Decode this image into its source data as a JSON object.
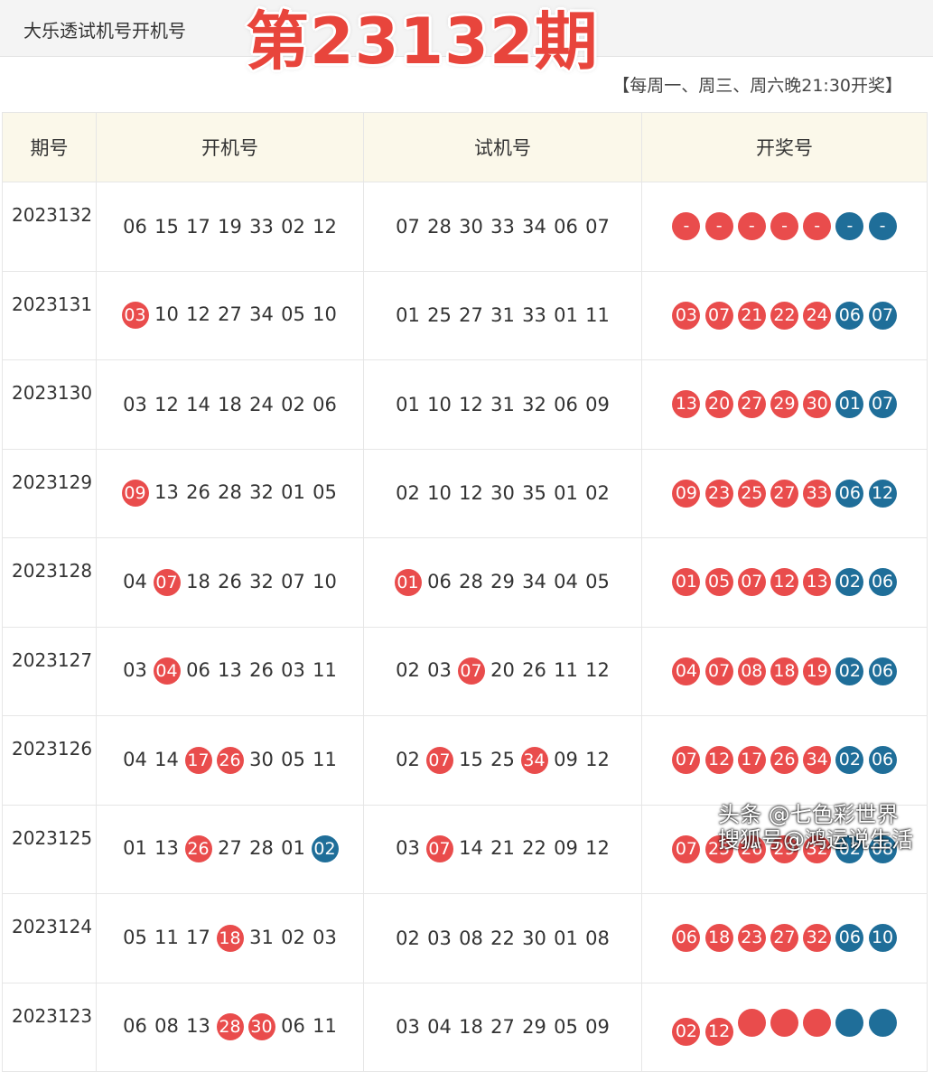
{
  "header": {
    "app_title": "大乐透试机号开机号",
    "issue_title": "第23132期",
    "schedule": "【每周一、周三、周六晚21:30开奖】"
  },
  "table": {
    "columns": [
      "期号",
      "开机号",
      "试机号",
      "开奖号"
    ],
    "rows": [
      {
        "issue": "2023132",
        "open": [
          [
            "06",
            ""
          ],
          [
            "15",
            ""
          ],
          [
            "17",
            ""
          ],
          [
            "19",
            ""
          ],
          [
            "33",
            ""
          ],
          [
            "02",
            ""
          ],
          [
            "12",
            ""
          ]
        ],
        "test": [
          [
            "07",
            ""
          ],
          [
            "28",
            ""
          ],
          [
            "30",
            ""
          ],
          [
            "33",
            ""
          ],
          [
            "34",
            ""
          ],
          [
            "06",
            ""
          ],
          [
            "07",
            ""
          ]
        ],
        "draw": [
          [
            "-",
            "red"
          ],
          [
            "-",
            "red"
          ],
          [
            "-",
            "red"
          ],
          [
            "-",
            "red"
          ],
          [
            "-",
            "red"
          ],
          [
            "-",
            "blue"
          ],
          [
            "-",
            "blue"
          ]
        ]
      },
      {
        "issue": "2023131",
        "open": [
          [
            "03",
            "hit"
          ],
          [
            "10",
            ""
          ],
          [
            "12",
            ""
          ],
          [
            "27",
            ""
          ],
          [
            "34",
            ""
          ],
          [
            "05",
            ""
          ],
          [
            "10",
            ""
          ]
        ],
        "test": [
          [
            "01",
            ""
          ],
          [
            "25",
            ""
          ],
          [
            "27",
            ""
          ],
          [
            "31",
            ""
          ],
          [
            "33",
            ""
          ],
          [
            "01",
            ""
          ],
          [
            "11",
            ""
          ]
        ],
        "draw": [
          [
            "03",
            "red"
          ],
          [
            "07",
            "red"
          ],
          [
            "21",
            "red"
          ],
          [
            "22",
            "red"
          ],
          [
            "24",
            "red"
          ],
          [
            "06",
            "blue"
          ],
          [
            "07",
            "blue"
          ]
        ]
      },
      {
        "issue": "2023130",
        "open": [
          [
            "03",
            ""
          ],
          [
            "12",
            ""
          ],
          [
            "14",
            ""
          ],
          [
            "18",
            ""
          ],
          [
            "24",
            ""
          ],
          [
            "02",
            ""
          ],
          [
            "06",
            ""
          ]
        ],
        "test": [
          [
            "01",
            ""
          ],
          [
            "10",
            ""
          ],
          [
            "12",
            ""
          ],
          [
            "31",
            ""
          ],
          [
            "32",
            ""
          ],
          [
            "06",
            ""
          ],
          [
            "09",
            ""
          ]
        ],
        "draw": [
          [
            "13",
            "red"
          ],
          [
            "20",
            "red"
          ],
          [
            "27",
            "red"
          ],
          [
            "29",
            "red"
          ],
          [
            "30",
            "red"
          ],
          [
            "01",
            "blue"
          ],
          [
            "07",
            "blue"
          ]
        ]
      },
      {
        "issue": "2023129",
        "open": [
          [
            "09",
            "hit"
          ],
          [
            "13",
            ""
          ],
          [
            "26",
            ""
          ],
          [
            "28",
            ""
          ],
          [
            "32",
            ""
          ],
          [
            "01",
            ""
          ],
          [
            "05",
            ""
          ]
        ],
        "test": [
          [
            "02",
            ""
          ],
          [
            "10",
            ""
          ],
          [
            "12",
            ""
          ],
          [
            "30",
            ""
          ],
          [
            "35",
            ""
          ],
          [
            "01",
            ""
          ],
          [
            "02",
            ""
          ]
        ],
        "draw": [
          [
            "09",
            "red"
          ],
          [
            "23",
            "red"
          ],
          [
            "25",
            "red"
          ],
          [
            "27",
            "red"
          ],
          [
            "33",
            "red"
          ],
          [
            "06",
            "blue"
          ],
          [
            "12",
            "blue"
          ]
        ]
      },
      {
        "issue": "2023128",
        "open": [
          [
            "04",
            ""
          ],
          [
            "07",
            "hit"
          ],
          [
            "18",
            ""
          ],
          [
            "26",
            ""
          ],
          [
            "32",
            ""
          ],
          [
            "07",
            ""
          ],
          [
            "10",
            ""
          ]
        ],
        "test": [
          [
            "01",
            "hit"
          ],
          [
            "06",
            ""
          ],
          [
            "28",
            ""
          ],
          [
            "29",
            ""
          ],
          [
            "34",
            ""
          ],
          [
            "04",
            ""
          ],
          [
            "05",
            ""
          ]
        ],
        "draw": [
          [
            "01",
            "red"
          ],
          [
            "05",
            "red"
          ],
          [
            "07",
            "red"
          ],
          [
            "12",
            "red"
          ],
          [
            "13",
            "red"
          ],
          [
            "02",
            "blue"
          ],
          [
            "06",
            "blue"
          ]
        ]
      },
      {
        "issue": "2023127",
        "open": [
          [
            "03",
            ""
          ],
          [
            "04",
            "hit"
          ],
          [
            "06",
            ""
          ],
          [
            "13",
            ""
          ],
          [
            "26",
            ""
          ],
          [
            "03",
            ""
          ],
          [
            "11",
            ""
          ]
        ],
        "test": [
          [
            "02",
            ""
          ],
          [
            "03",
            ""
          ],
          [
            "07",
            "hit"
          ],
          [
            "20",
            ""
          ],
          [
            "26",
            ""
          ],
          [
            "11",
            ""
          ],
          [
            "12",
            ""
          ]
        ],
        "draw": [
          [
            "04",
            "red"
          ],
          [
            "07",
            "red"
          ],
          [
            "08",
            "red"
          ],
          [
            "18",
            "red"
          ],
          [
            "19",
            "red"
          ],
          [
            "02",
            "blue"
          ],
          [
            "06",
            "blue"
          ]
        ]
      },
      {
        "issue": "2023126",
        "open": [
          [
            "04",
            ""
          ],
          [
            "14",
            ""
          ],
          [
            "17",
            "hit"
          ],
          [
            "26",
            "hit"
          ],
          [
            "30",
            ""
          ],
          [
            "05",
            ""
          ],
          [
            "11",
            ""
          ]
        ],
        "test": [
          [
            "02",
            ""
          ],
          [
            "07",
            "hit"
          ],
          [
            "15",
            ""
          ],
          [
            "25",
            ""
          ],
          [
            "34",
            "hit"
          ],
          [
            "09",
            ""
          ],
          [
            "12",
            ""
          ]
        ],
        "draw": [
          [
            "07",
            "red"
          ],
          [
            "12",
            "red"
          ],
          [
            "17",
            "red"
          ],
          [
            "26",
            "red"
          ],
          [
            "34",
            "red"
          ],
          [
            "02",
            "blue"
          ],
          [
            "06",
            "blue"
          ]
        ]
      },
      {
        "issue": "2023125",
        "open": [
          [
            "01",
            ""
          ],
          [
            "13",
            ""
          ],
          [
            "26",
            "hit"
          ],
          [
            "27",
            ""
          ],
          [
            "28",
            ""
          ],
          [
            "01",
            ""
          ],
          [
            "02",
            "blue"
          ]
        ],
        "test": [
          [
            "03",
            ""
          ],
          [
            "07",
            "hit"
          ],
          [
            "14",
            ""
          ],
          [
            "21",
            ""
          ],
          [
            "22",
            ""
          ],
          [
            "09",
            ""
          ],
          [
            "12",
            ""
          ]
        ],
        "draw": [
          [
            "07",
            "red"
          ],
          [
            "25",
            "red"
          ],
          [
            "26",
            "red"
          ],
          [
            "29",
            "red"
          ],
          [
            "32",
            "red"
          ],
          [
            "02",
            "blue"
          ],
          [
            "08",
            "blue"
          ]
        ]
      },
      {
        "issue": "2023124",
        "open": [
          [
            "05",
            ""
          ],
          [
            "11",
            ""
          ],
          [
            "17",
            ""
          ],
          [
            "18",
            "hit"
          ],
          [
            "31",
            ""
          ],
          [
            "02",
            ""
          ],
          [
            "03",
            ""
          ]
        ],
        "test": [
          [
            "02",
            ""
          ],
          [
            "03",
            ""
          ],
          [
            "08",
            ""
          ],
          [
            "22",
            ""
          ],
          [
            "30",
            ""
          ],
          [
            "01",
            ""
          ],
          [
            "08",
            ""
          ]
        ],
        "draw": [
          [
            "06",
            "red"
          ],
          [
            "18",
            "red"
          ],
          [
            "23",
            "red"
          ],
          [
            "27",
            "red"
          ],
          [
            "32",
            "red"
          ],
          [
            "06",
            "blue"
          ],
          [
            "10",
            "blue"
          ]
        ]
      },
      {
        "issue": "2023123",
        "open": [
          [
            "06",
            ""
          ],
          [
            "08",
            ""
          ],
          [
            "13",
            ""
          ],
          [
            "28",
            "hit"
          ],
          [
            "30",
            "hit"
          ],
          [
            "06",
            ""
          ],
          [
            "11",
            ""
          ]
        ],
        "test": [
          [
            "03",
            ""
          ],
          [
            "04",
            ""
          ],
          [
            "18",
            ""
          ],
          [
            "27",
            ""
          ],
          [
            "29",
            ""
          ],
          [
            "05",
            ""
          ],
          [
            "09",
            ""
          ]
        ],
        "draw": [
          [
            "02",
            "red"
          ],
          [
            "12",
            "red"
          ],
          [
            "",
            "red"
          ],
          [
            "",
            "red"
          ],
          [
            "",
            "red"
          ],
          [
            "",
            "blue"
          ],
          [
            "",
            "blue"
          ]
        ]
      }
    ]
  },
  "watermark": {
    "line1": "头条 @七色彩世界",
    "line2": "搜狐号@鸿运说生活"
  },
  "colors": {
    "red_ball": "#e94c4c",
    "blue_ball": "#1f6e99",
    "title_red": "#e8453c",
    "header_bg": "#fbf8ea"
  }
}
